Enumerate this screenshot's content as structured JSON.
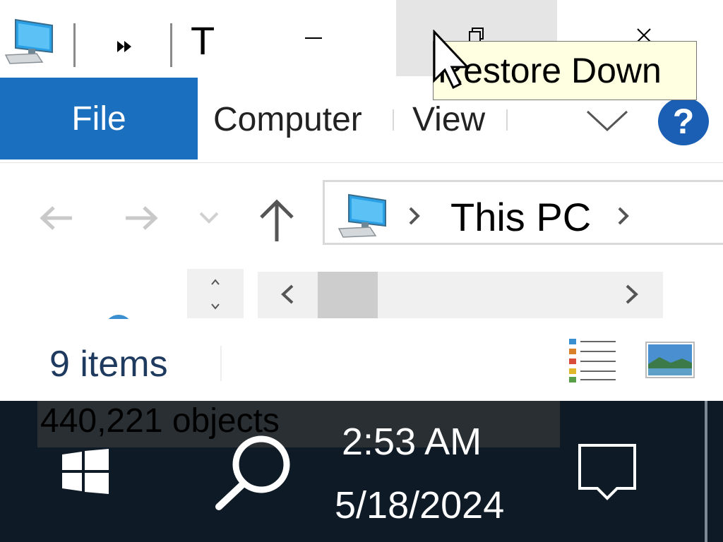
{
  "titlebar": {
    "title": "T",
    "tooltip": "Restore Down"
  },
  "ribbon": {
    "tabs": [
      "File",
      "Computer",
      "View"
    ],
    "help_label": "?"
  },
  "address": {
    "location": "This PC"
  },
  "statusbar": {
    "items_count": "9 items"
  },
  "taskbar": {
    "tooltip": "440,221 objects",
    "time": "2:53 AM",
    "date": "5/18/2024"
  },
  "icons": {
    "app": "this-pc-icon",
    "overflow": "double-chevron-right-icon",
    "back": "arrow-left-icon",
    "forward": "arrow-right-icon",
    "recent": "chevron-down-icon",
    "up": "arrow-up-icon",
    "start": "windows-logo-icon",
    "search": "search-icon",
    "notifications": "action-center-icon"
  },
  "colors": {
    "file_tab": "#1a6fbf",
    "taskbar": "#0e1a26",
    "tooltip_bg": "#ffffe1",
    "help": "#1a5fb4"
  }
}
